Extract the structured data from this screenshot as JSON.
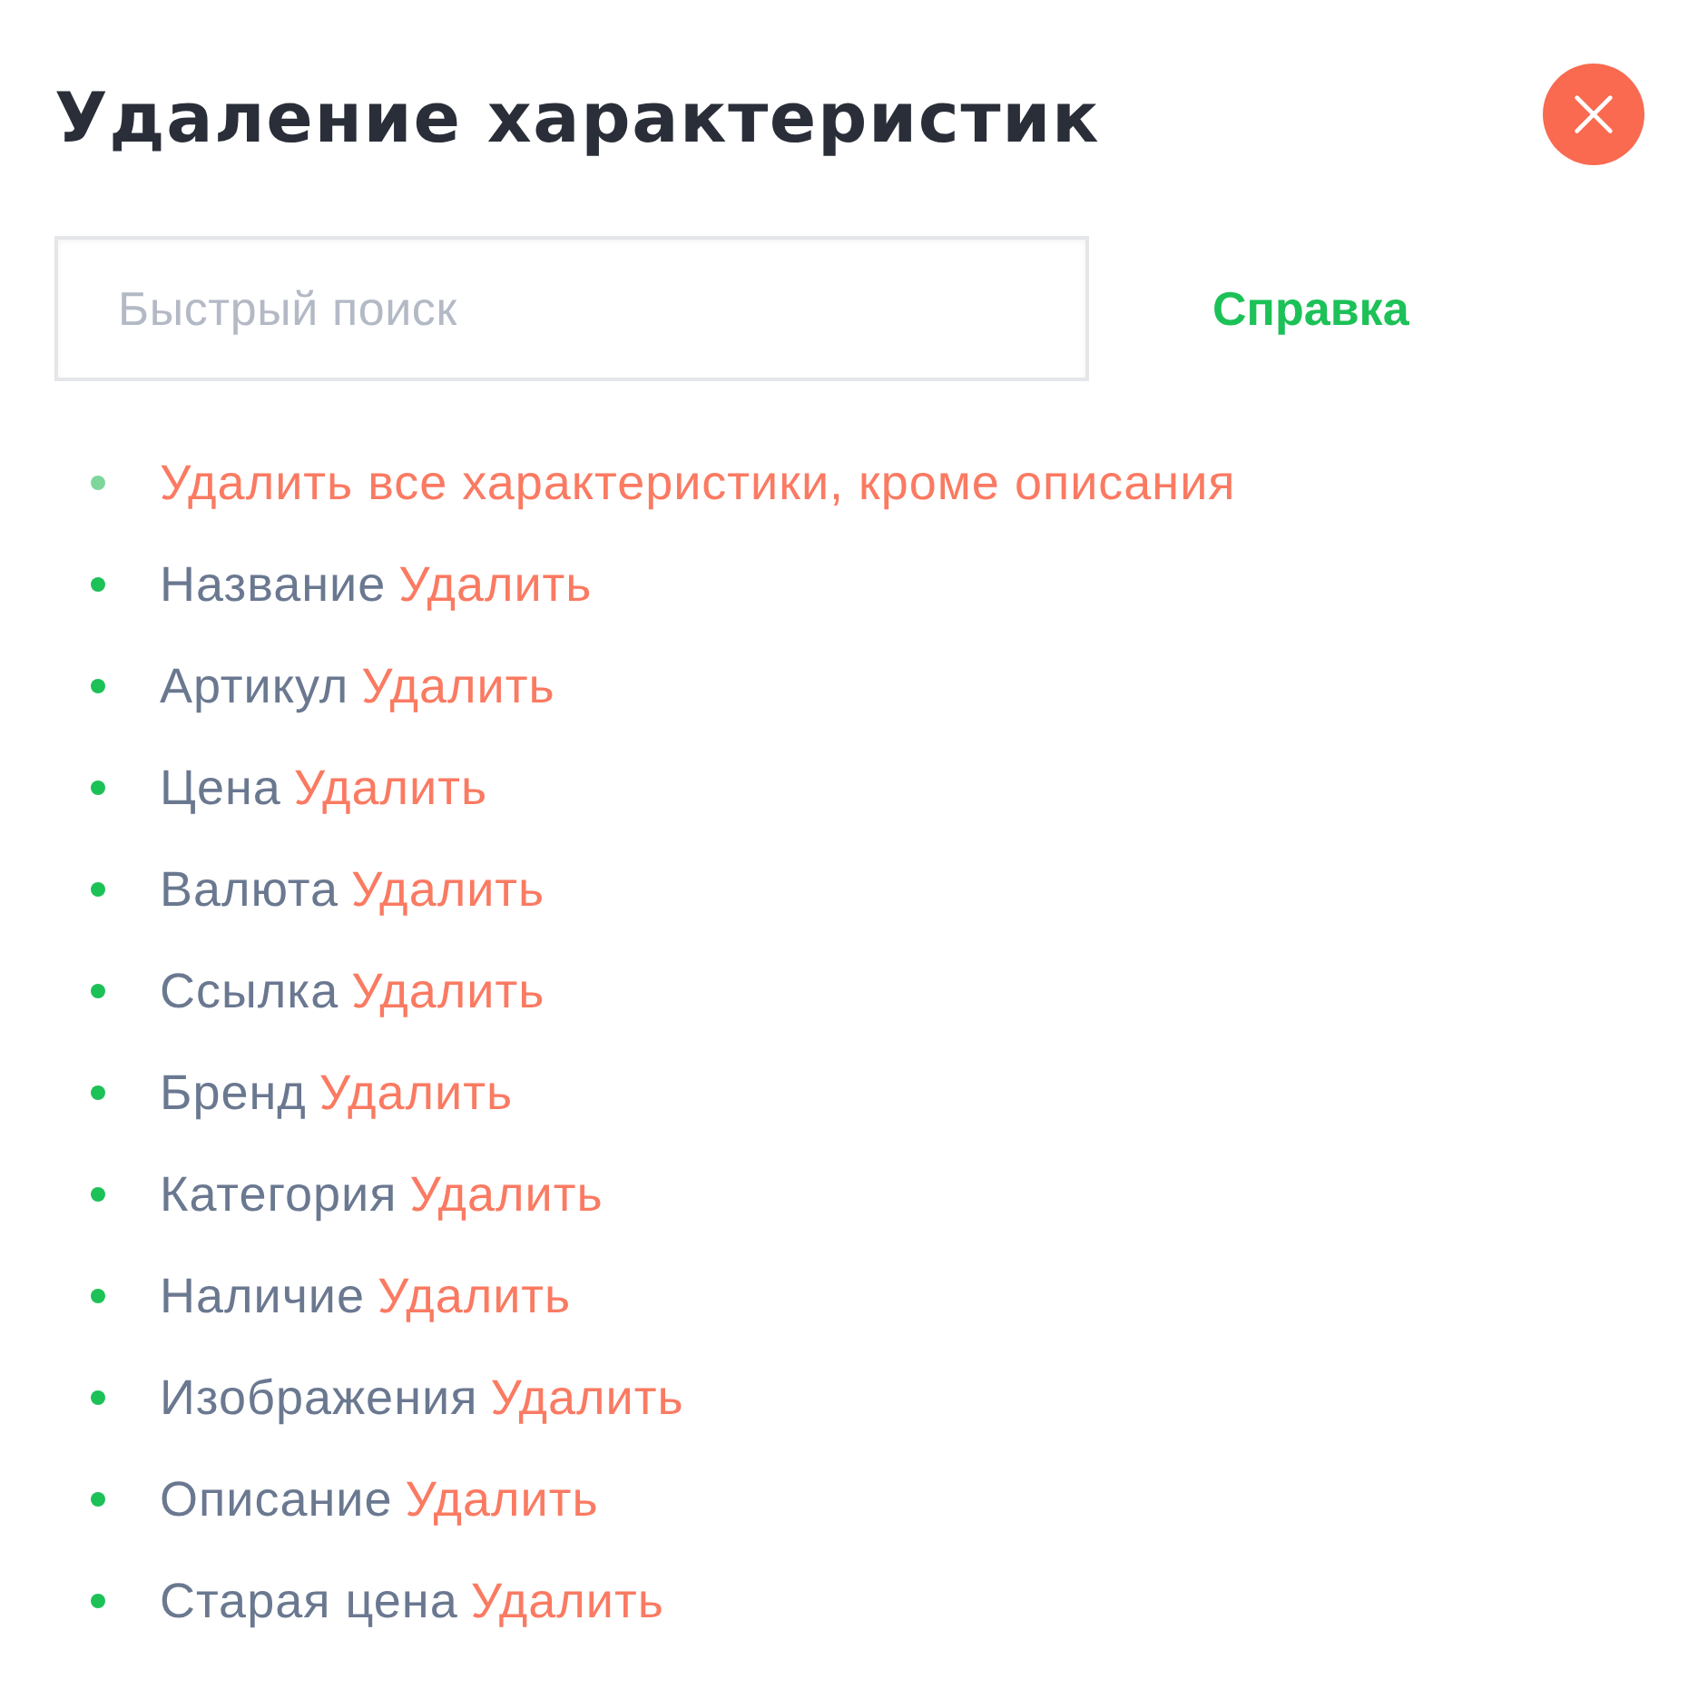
{
  "title": "Удаление характеристик",
  "search": {
    "placeholder": "Быстрый поиск"
  },
  "help_link": "Справка",
  "items": [
    {
      "kind": "remove-all",
      "action": "Удалить все характеристики, кроме описания"
    },
    {
      "kind": "field",
      "name": "Название",
      "action": "Удалить"
    },
    {
      "kind": "field",
      "name": "Артикул",
      "action": "Удалить"
    },
    {
      "kind": "field",
      "name": "Цена",
      "action": "Удалить"
    },
    {
      "kind": "field",
      "name": "Валюта",
      "action": "Удалить"
    },
    {
      "kind": "field",
      "name": "Ссылка",
      "action": "Удалить"
    },
    {
      "kind": "field",
      "name": "Бренд",
      "action": "Удалить"
    },
    {
      "kind": "field",
      "name": "Категория",
      "action": "Удалить"
    },
    {
      "kind": "field",
      "name": "Наличие",
      "action": "Удалить"
    },
    {
      "kind": "field",
      "name": "Изображения",
      "action": "Удалить"
    },
    {
      "kind": "field",
      "name": "Описание",
      "action": "Удалить"
    },
    {
      "kind": "field",
      "name": "Старая цена",
      "action": "Удалить"
    }
  ]
}
